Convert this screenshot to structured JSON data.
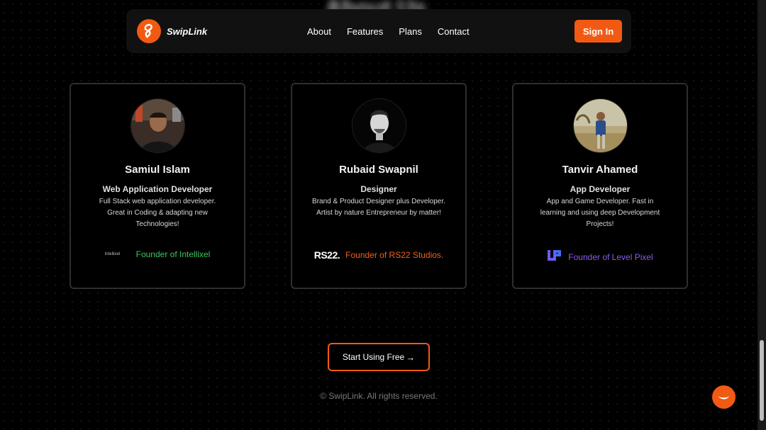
{
  "background_heading": "About Us",
  "navbar": {
    "brand": "SwipLink",
    "links": [
      "About",
      "Features",
      "Plans",
      "Contact"
    ],
    "signin_label": "Sign In"
  },
  "team": [
    {
      "name": "Samiul Islam",
      "role": "Web Application Developer",
      "description": "Full Stack web application developer. Great in Coding & adapting new Technologies!",
      "founder_text": "Founder of Intellixel",
      "founder_logo_text": "Intellixel",
      "founder_color": "#3ec45f"
    },
    {
      "name": "Rubaid Swapnil",
      "role": "Designer",
      "description": "Brand & Product Designer plus Developer. Artist by nature Entrepreneur by matter!",
      "founder_text": "Founder of RS22 Studios.",
      "founder_logo_text": "RS22.",
      "founder_color": "#f2601c"
    },
    {
      "name": "Tanvir Ahamed",
      "role": "App Developer",
      "description": "App and Game Developer. Fast in learning and using deep Development Projects!",
      "founder_text": "Founder of Level Pixel",
      "founder_logo_text": "LP",
      "founder_color": "#8a5cf0"
    }
  ],
  "cta_label": "Start Using Free",
  "cta_arrow": "→",
  "footer": "© SwipLink. All rights reserved.",
  "colors": {
    "accent": "#f25a14",
    "card_border": "#2e2e2e",
    "background": "#000000"
  },
  "icons": {
    "logo": "swiplink-logo-icon",
    "chat": "chat-bubble-icon",
    "arrow": "arrow-right-icon"
  }
}
